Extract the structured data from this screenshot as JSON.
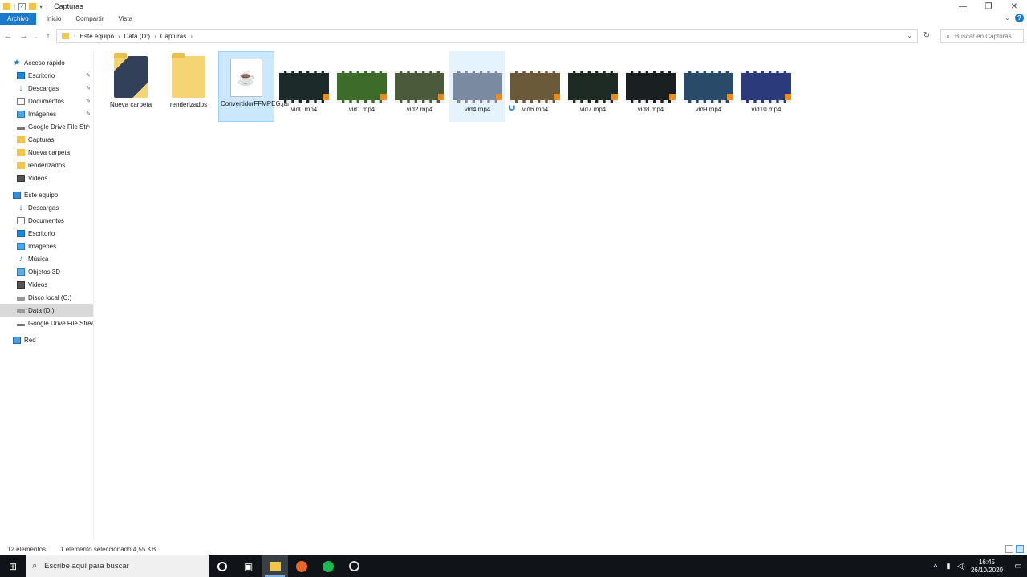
{
  "window": {
    "title": "Capturas",
    "controls": {
      "minimize": "—",
      "maximize": "❐",
      "close": "✕"
    }
  },
  "ribbon": {
    "tabs": [
      {
        "label": "Archivo"
      },
      {
        "label": "Inicio"
      },
      {
        "label": "Compartir"
      },
      {
        "label": "Vista"
      }
    ]
  },
  "address": {
    "crumbs": [
      "Este equipo",
      "Data (D:)",
      "Capturas"
    ],
    "search_placeholder": "Buscar en Capturas"
  },
  "nav": {
    "items": [
      {
        "label": "Acceso rápido",
        "icon": "star-icon",
        "indent": 0,
        "pinned": false
      },
      {
        "label": "Escritorio",
        "icon": "desktop-icon",
        "indent": 1,
        "pinned": true
      },
      {
        "label": "Descargas",
        "icon": "downloads-icon",
        "indent": 1,
        "pinned": true
      },
      {
        "label": "Documentos",
        "icon": "documents-icon",
        "indent": 1,
        "pinned": true
      },
      {
        "label": "Imágenes",
        "icon": "pictures-icon",
        "indent": 1,
        "pinned": true
      },
      {
        "label": "Google Drive File Str",
        "icon": "drive-icon",
        "indent": 1,
        "pinned": true
      },
      {
        "label": "Capturas",
        "icon": "folder-icon",
        "indent": 1,
        "pinned": false
      },
      {
        "label": "Nueva carpeta",
        "icon": "folder-icon",
        "indent": 1,
        "pinned": false
      },
      {
        "label": "renderizados",
        "icon": "folder-icon",
        "indent": 1,
        "pinned": false
      },
      {
        "label": "Videos",
        "icon": "videos-icon",
        "indent": 1,
        "pinned": false
      },
      {
        "label": "Este equipo",
        "icon": "pc-icon",
        "indent": 0,
        "pinned": false
      },
      {
        "label": "Descargas",
        "icon": "downloads-icon",
        "indent": 1,
        "pinned": false
      },
      {
        "label": "Documentos",
        "icon": "documents-icon",
        "indent": 1,
        "pinned": false
      },
      {
        "label": "Escritorio",
        "icon": "desktop-icon",
        "indent": 1,
        "pinned": false
      },
      {
        "label": "Imágenes",
        "icon": "pictures-icon",
        "indent": 1,
        "pinned": false
      },
      {
        "label": "Música",
        "icon": "music-icon",
        "indent": 1,
        "pinned": false
      },
      {
        "label": "Objetos 3D",
        "icon": "objects-3d-icon",
        "indent": 1,
        "pinned": false
      },
      {
        "label": "Videos",
        "icon": "videos-icon",
        "indent": 1,
        "pinned": false
      },
      {
        "label": "Disco local (C:)",
        "icon": "disk-icon",
        "indent": 1,
        "pinned": false
      },
      {
        "label": "Data (D:)",
        "icon": "disk-icon",
        "indent": 1,
        "pinned": false,
        "selected": true
      },
      {
        "label": "Google Drive File Stream",
        "icon": "drive-icon",
        "indent": 1,
        "pinned": false
      },
      {
        "label": "Red",
        "icon": "network-icon",
        "indent": 0,
        "pinned": false
      }
    ]
  },
  "files": [
    {
      "name": "Nueva carpeta",
      "kind": "folder-dark"
    },
    {
      "name": "renderizados",
      "kind": "folder"
    },
    {
      "name": "ConvertidorFFMPEG.jar",
      "kind": "jar",
      "selected": true
    },
    {
      "name": "vid0.mp4",
      "kind": "video",
      "color": "#1d2a2a"
    },
    {
      "name": "vid1.mp4",
      "kind": "video",
      "color": "#3d6b2a"
    },
    {
      "name": "vid2.mp4",
      "kind": "video",
      "color": "#4a5a3a"
    },
    {
      "name": "vid4.mp4",
      "kind": "video",
      "color": "#7a8aa0",
      "hover": true
    },
    {
      "name": "vid6.mp4",
      "kind": "video",
      "color": "#6a5a3a"
    },
    {
      "name": "vid7.mp4",
      "kind": "video",
      "color": "#1e2a24"
    },
    {
      "name": "vid8.mp4",
      "kind": "video",
      "color": "#1a1f22"
    },
    {
      "name": "vid9.mp4",
      "kind": "video",
      "color": "#2a4a6a"
    },
    {
      "name": "vid10.mp4",
      "kind": "video",
      "color": "#2a3a7a"
    }
  ],
  "status": {
    "count": "12 elementos",
    "selection": "1 elemento seleccionado  4,55 KB"
  },
  "taskbar": {
    "search_placeholder": "Escribe aquí para buscar",
    "time": "16:45",
    "date": "26/10/2020",
    "notif_count": "3"
  },
  "colors": {
    "accent": "#1979ca",
    "selection": "#cce8ff",
    "taskbar": "#101418"
  }
}
